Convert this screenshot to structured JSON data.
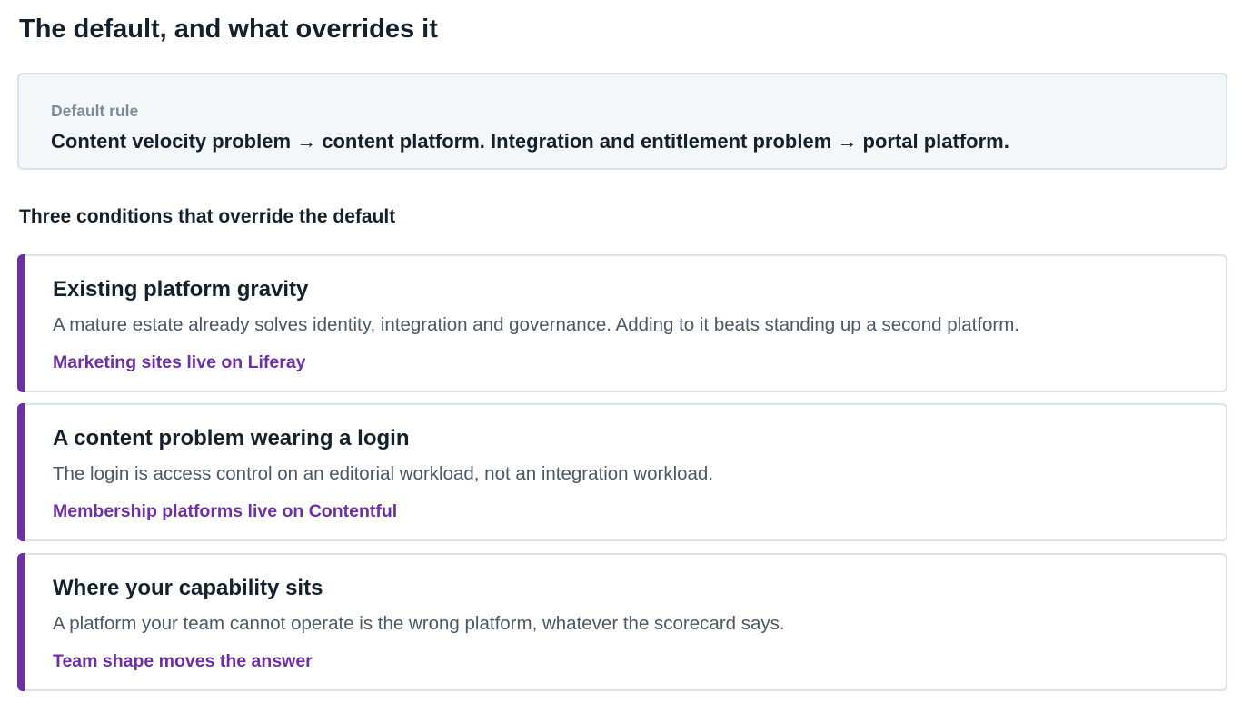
{
  "page_title": "The default, and what overrides it",
  "default_rule": {
    "label": "Default rule",
    "text": "Content velocity problem → content platform. Integration and entitlement problem → portal platform."
  },
  "conditions_heading": "Three conditions that override the default",
  "conditions": [
    {
      "title": "Existing platform gravity",
      "body": "A mature estate already solves identity, integration and governance. Adding to it beats standing up a second platform.",
      "link": "Marketing sites live on Liferay"
    },
    {
      "title": "A content problem wearing a login",
      "body": "The login is access control on an editorial workload, not an integration workload.",
      "link": "Membership platforms live on Contentful"
    },
    {
      "title": "Where your capability sits",
      "body": "A platform your team cannot operate is the wrong platform, whatever the scorecard says.",
      "link": "Team shape moves the answer"
    }
  ],
  "colors": {
    "accent": "#6d2fa3",
    "title_text": "#14202b",
    "body_text": "#4a5866",
    "muted_label": "#7d8b97",
    "default_box_bg": "#f4f7fa",
    "border": "#dbe3ea"
  }
}
